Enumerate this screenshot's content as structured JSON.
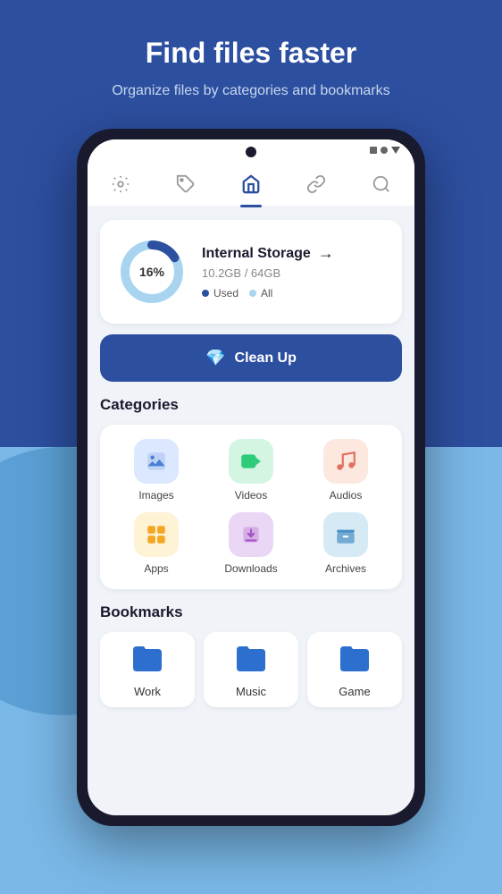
{
  "background": {
    "top_color": "#2d4fa0",
    "bottom_color": "#7ab8e8"
  },
  "header": {
    "title": "Find files faster",
    "subtitle": "Organize files by categories and bookmarks"
  },
  "statusBar": {
    "camera": true,
    "battery_label": "battery",
    "signal_label": "signal"
  },
  "navbar": {
    "items": [
      {
        "name": "settings",
        "icon": "⚙",
        "active": false
      },
      {
        "name": "tag",
        "icon": "🏷",
        "active": false
      },
      {
        "name": "home",
        "icon": "⌂",
        "active": true
      },
      {
        "name": "link",
        "icon": "🔗",
        "active": false
      },
      {
        "name": "search",
        "icon": "🔍",
        "active": false
      }
    ]
  },
  "storage": {
    "title": "Internal Storage",
    "used_gb": "10.2GB",
    "total_gb": "64GB",
    "size_text": "10.2GB / 64GB",
    "percent": 16,
    "percent_label": "16%",
    "legend_used": "Used",
    "legend_all": "All",
    "arrow": "→",
    "donut_used_color": "#2d4fa0",
    "donut_all_color": "#a8d4f0"
  },
  "cleanup": {
    "label": "Clean Up",
    "icon": "💎"
  },
  "categories": {
    "section_title": "Categories",
    "items": [
      {
        "name": "Images",
        "icon": "🖼",
        "bg_class": "cat-images"
      },
      {
        "name": "Videos",
        "icon": "🎬",
        "bg_class": "cat-videos"
      },
      {
        "name": "Audios",
        "icon": "🎵",
        "bg_class": "cat-audios"
      },
      {
        "name": "Apps",
        "icon": "⠿",
        "bg_class": "cat-apps"
      },
      {
        "name": "Downloads",
        "icon": "⬇",
        "bg_class": "cat-downloads"
      },
      {
        "name": "Archives",
        "icon": "📦",
        "bg_class": "cat-archives"
      }
    ]
  },
  "bookmarks": {
    "section_title": "Bookmarks",
    "items": [
      {
        "name": "Work",
        "color": "#2d6fcf"
      },
      {
        "name": "Music",
        "color": "#2d6fcf"
      },
      {
        "name": "Game",
        "color": "#2d6fcf"
      }
    ]
  }
}
